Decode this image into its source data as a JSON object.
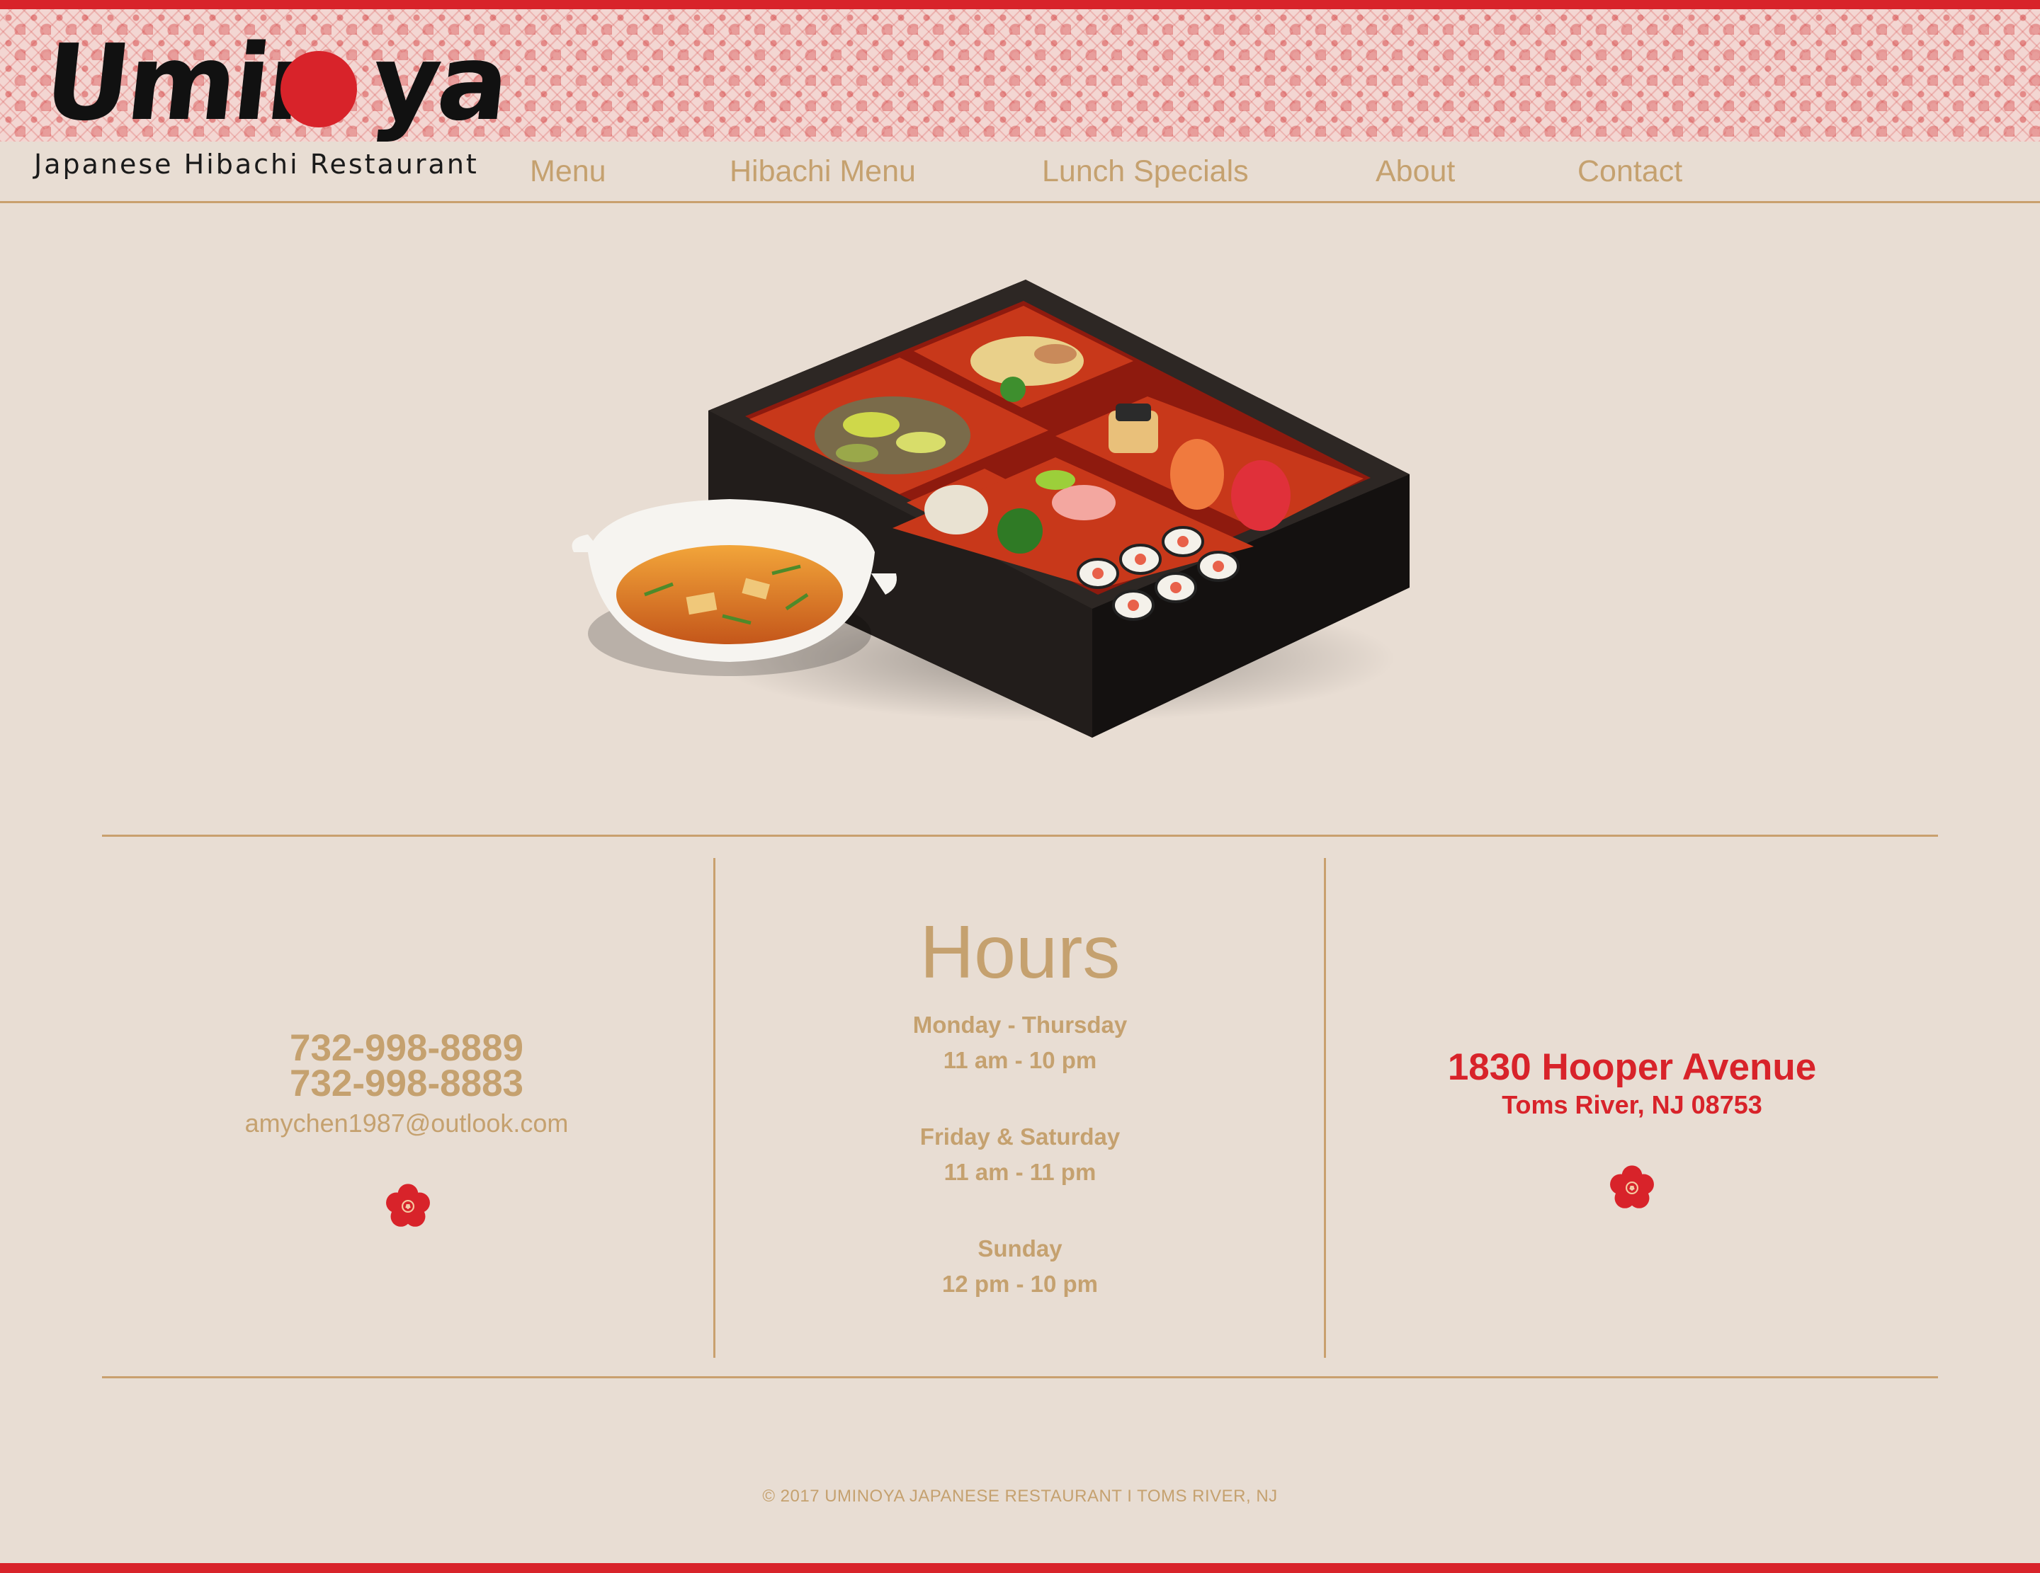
{
  "brand": {
    "logo_text": "Umin ya",
    "tagline": "Japanese Hibachi Restaurant",
    "accent_color": "#d8232a",
    "gold_color": "#c5a16f"
  },
  "nav": {
    "items": [
      {
        "label": "Menu"
      },
      {
        "label": "Hibachi Menu"
      },
      {
        "label": "Lunch Specials"
      },
      {
        "label": "About"
      },
      {
        "label": "Contact"
      }
    ]
  },
  "hero": {
    "image_icon": "bento-box-with-miso-soup"
  },
  "contact": {
    "phone_1": "732-998-8889",
    "phone_2": "732-998-8883",
    "email": "amychen1987@outlook.com",
    "icon": "cherry-blossom-icon"
  },
  "hours": {
    "title": "Hours",
    "entries": [
      {
        "days": "Monday - Thursday",
        "time": "11 am - 10 pm"
      },
      {
        "days": "Friday & Saturday",
        "time": "11 am - 11 pm"
      },
      {
        "days": "Sunday",
        "time": "12 pm - 10 pm"
      }
    ]
  },
  "address": {
    "street": "1830 Hooper Avenue",
    "city": "Toms River, NJ 08753",
    "icon": "cherry-blossom-icon"
  },
  "footer": {
    "copyright": "© 2017 UMINOYA JAPANESE RESTAURANT I TOMS RIVER, NJ"
  }
}
